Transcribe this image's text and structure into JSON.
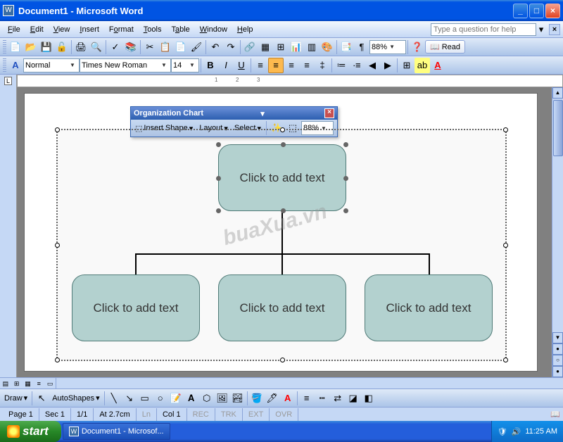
{
  "window": {
    "title": "Document1 - Microsoft Word"
  },
  "menu": {
    "items": [
      "File",
      "Edit",
      "View",
      "Insert",
      "Format",
      "Tools",
      "Table",
      "Window",
      "Help"
    ],
    "helpPlaceholder": "Type a question for help"
  },
  "toolbar1": {
    "zoom": "88%",
    "readLabel": "Read"
  },
  "toolbar2": {
    "styleIcon": "A",
    "style": "Normal",
    "font": "Times New Roman",
    "size": "14"
  },
  "floatToolbar": {
    "title": "Organization Chart",
    "insertShape": "Insert Shape",
    "layout": "Layout",
    "select": "Select",
    "zoom": "88%"
  },
  "orgchart": {
    "topBox": "Click to add text",
    "box1": "Click to add text",
    "box2": "Click to add text",
    "box3": "Click to add text"
  },
  "drawToolbar": {
    "drawLabel": "Draw",
    "autoshapes": "AutoShapes"
  },
  "statusbar": {
    "page": "Page 1",
    "sec": "Sec 1",
    "pages": "1/1",
    "at": "At 2.7cm",
    "ln": "Ln",
    "col": "Col 1",
    "rec": "REC",
    "trk": "TRK",
    "ext": "EXT",
    "ovr": "OVR"
  },
  "taskbar": {
    "start": "start",
    "taskItem": "Document1 - Microsof...",
    "time": "11:25 AM"
  },
  "watermark": "buaXua.vn"
}
